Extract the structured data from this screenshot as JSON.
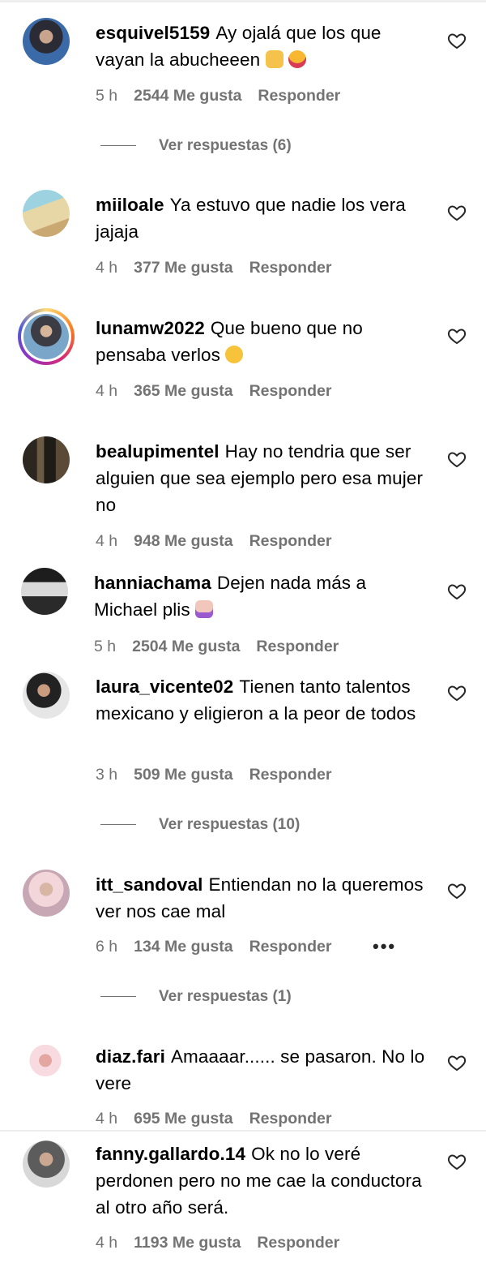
{
  "comments": [
    {
      "user": "esquivel5159",
      "text": "Ay ojalá que los que vayan la abucheeen",
      "time": "5 h",
      "likes": "2544 Me gusta",
      "reply": "Responder"
    },
    {
      "user": "miiloale",
      "text": "Ya estuvo que nadie los vera jajaja",
      "time": "4 h",
      "likes": "377 Me gusta",
      "reply": "Responder"
    },
    {
      "user": "lunamw2022",
      "text": "Que bueno que no pensaba verlos",
      "time": "4 h",
      "likes": "365 Me gusta",
      "reply": "Responder"
    },
    {
      "user": "bealupimentel",
      "text": "Hay no tendria que ser alguien que sea ejemplo pero esa mujer no",
      "time": "4 h",
      "likes": "948 Me gusta",
      "reply": "Responder"
    },
    {
      "user": "hanniachama",
      "text": "Dejen nada más a Michael plis",
      "time": "5 h",
      "likes": "2504 Me gusta",
      "reply": "Responder"
    },
    {
      "user": "laura_vicente02",
      "text": "Tienen tanto talentos mexicano y eligieron a la peor de todos",
      "time": "3 h",
      "likes": "509 Me gusta",
      "reply": "Responder"
    },
    {
      "user": "itt_sandoval",
      "text": "Entiendan no la queremos ver nos cae mal",
      "time": "6 h",
      "likes": "134 Me gusta",
      "reply": "Responder"
    },
    {
      "user": "diaz.fari",
      "text": "Amaaaar...... se pasaron. No lo vere",
      "time": "4 h",
      "likes": "695 Me gusta",
      "reply": "Responder"
    },
    {
      "user": "fanny.gallardo.14",
      "text": "Ok no lo veré perdonen pero no me cae la conductora al otro año será.",
      "time": "4 h",
      "likes": "1193 Me gusta",
      "reply": "Responder"
    }
  ],
  "view_replies": [
    {
      "label": "Ver respuestas (6)"
    },
    {
      "label": "Ver respuestas (10)"
    },
    {
      "label": "Ver respuestas (1)"
    }
  ],
  "more_label": "•••",
  "icons": {
    "like": "heart-outline-icon",
    "more": "more-options-icon"
  },
  "colors": {
    "meta": "#737373",
    "text": "#000000",
    "divider": "#ececec"
  }
}
